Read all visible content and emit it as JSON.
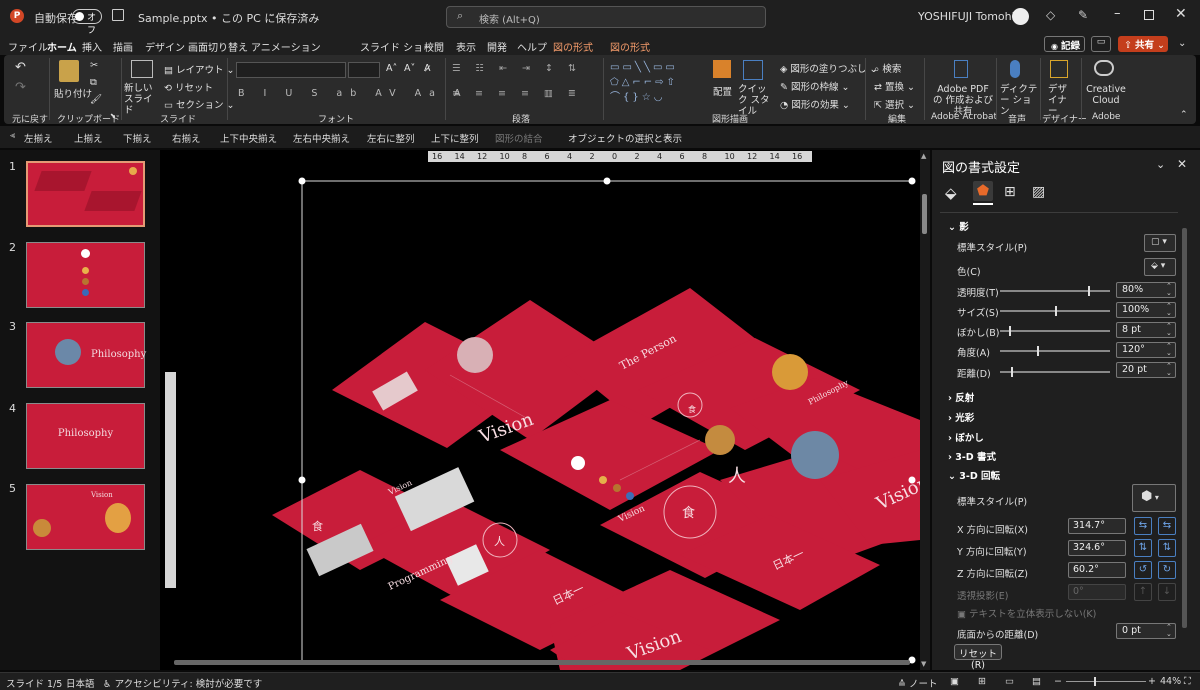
{
  "titlebar": {
    "autosave_label": "自動保存",
    "autosave_state": "オフ",
    "doc_title": "Sample.pptx • この PC に保存済み",
    "search_placeholder": "検索 (Alt+Q)",
    "user_name": "YOSHIFUJI Tomohiro"
  },
  "menu": {
    "tabs": [
      "ファイル",
      "ホーム",
      "挿入",
      "描画",
      "デザイン",
      "画面切り替え",
      "アニメーション",
      "スライド ショー",
      "校閲",
      "表示",
      "開発",
      "ヘルプ",
      "図の形式",
      "図の形式"
    ],
    "record": "記録",
    "share": "共有"
  },
  "ribbon": {
    "undo_group": "元に戻す",
    "paste": "貼り付け",
    "clipboard": "クリップボード",
    "new_slide": "新しい スライド",
    "layout": "レイアウト",
    "reset": "リセット",
    "section": "セクション",
    "slides_group": "スライド",
    "font_group": "フォント",
    "paragraph_group": "段落",
    "arrange": "配置",
    "quick_style": "クイック スタイル",
    "shape_fill": "図形の塗りつぶし",
    "shape_outline": "図形の枠線",
    "shape_effect": "図形の効果",
    "drawing_group": "図形描画",
    "find": "検索",
    "replace": "置換",
    "select": "選択",
    "edit_group": "編集",
    "adobe_pdf": "Adobe PDF の 作成および共有",
    "adobe_acrobat": "Adobe Acrobat",
    "dictation": "ディクテー ション",
    "voice_group": "音声",
    "designer": "デザ イナー",
    "designer_group": "デザイナー",
    "creative_cloud": "Creative Cloud",
    "adobe_group": "Adobe"
  },
  "qat": [
    "左揃え",
    "上揃え",
    "下揃え",
    "右揃え",
    "上下中央揃え",
    "左右中央揃え",
    "左右に整列",
    "上下に整列",
    "図形の結合",
    "オブジェクトの選択と表示"
  ],
  "ruler_ticks": [
    "16",
    "14",
    "12",
    "10",
    "8",
    "6",
    "4",
    "2",
    "0",
    "2",
    "4",
    "6",
    "8",
    "10",
    "12",
    "14",
    "16"
  ],
  "thumbnails": [
    {
      "num": "1",
      "text": ""
    },
    {
      "num": "2",
      "text": ""
    },
    {
      "num": "3",
      "text": "Philosophy"
    },
    {
      "num": "4",
      "text": "Philosophy"
    },
    {
      "num": "5",
      "text": "Vision"
    }
  ],
  "slide_texts": {
    "vision_a": "Vision",
    "person": "The Person",
    "philosophy": "Philosophy",
    "vision_b": "Vision",
    "vision_c": "Vision",
    "shoku": "食",
    "hito": "人",
    "programming": "Programming",
    "nihon": "日本一"
  },
  "pane": {
    "title": "図の書式設定",
    "shadow": {
      "heading": "影",
      "preset": "標準スタイル(P)",
      "color": "色(C)",
      "transparency_label": "透明度(T)",
      "transparency": "80%",
      "size_label": "サイズ(S)",
      "size": "100%",
      "blur_label": "ぼかし(B)",
      "blur": "8 pt",
      "angle_label": "角度(A)",
      "angle": "120°",
      "distance_label": "距離(D)",
      "distance": "20 pt"
    },
    "sections": [
      "反射",
      "光彩",
      "ぼかし",
      "3-D 書式"
    ],
    "rotation": {
      "heading": "3-D 回転",
      "preset": "標準スタイル(P)",
      "x_label": "X 方向に回転(X)",
      "x": "314.7°",
      "y_label": "Y 方向に回転(Y)",
      "y": "324.6°",
      "z_label": "Z 方向に回転(Z)",
      "z": "60.2°",
      "persp_label": "透視投影(E)",
      "persp": "0°",
      "keep_flat": "テキストを立体表示しない(K)",
      "dist_label": "底面からの距離(D)",
      "dist": "0 pt",
      "reset": "リセット(R)"
    }
  },
  "status": {
    "slide": "スライド 1/5",
    "lang": "日本語",
    "accessibility": "アクセシビリティ: 検討が必要です",
    "notes": "ノート",
    "zoom": "44%"
  },
  "colors": {
    "slide_red": "#c81d3a",
    "accent": "#d24726",
    "ctx_tab": "#f29a6a",
    "share": "#c43e1c"
  }
}
